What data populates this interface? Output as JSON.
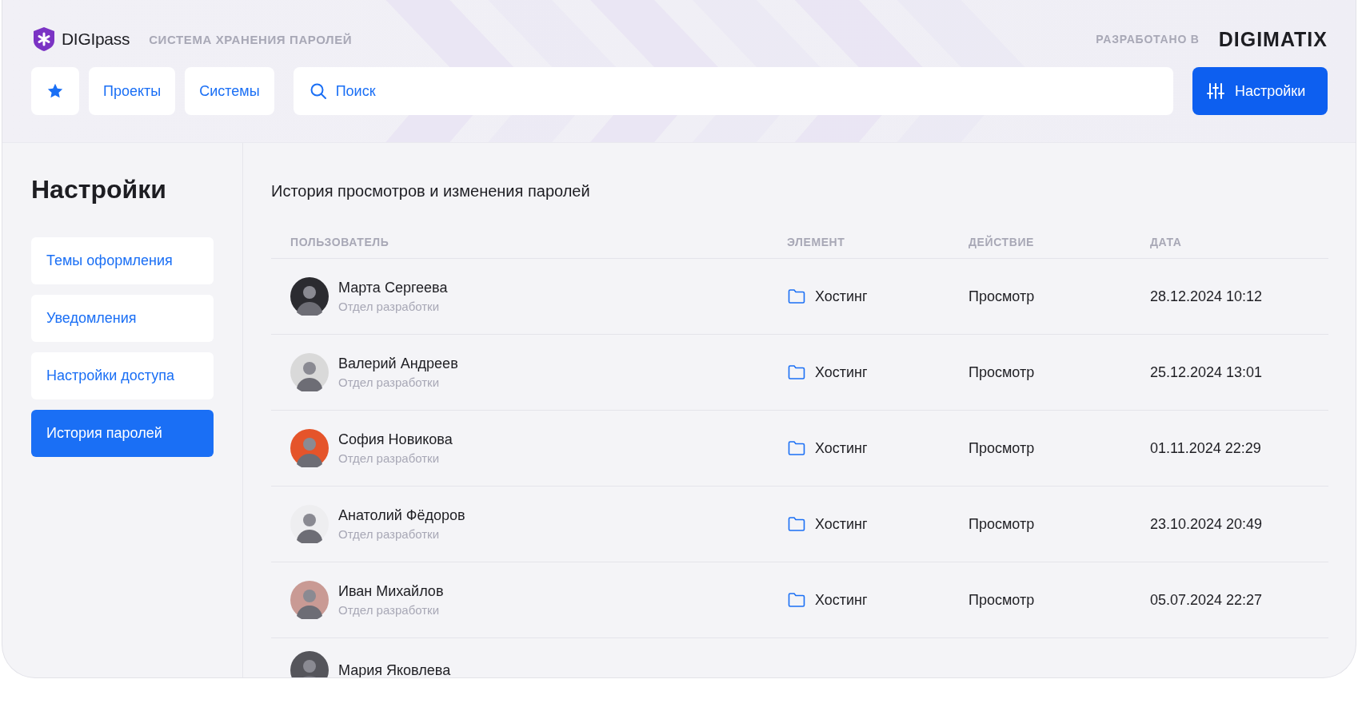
{
  "header": {
    "brand": "DIGIpass",
    "tagline": "СИСТЕМА ХРАНЕНИЯ ПАРОЛЕЙ",
    "credit": "РАЗРАБОТАНО В",
    "company": "DIGIMATIX",
    "nav": [
      "Проекты",
      "Системы"
    ],
    "search": {
      "placeholder": "Поиск"
    },
    "settings_button": "Настройки"
  },
  "sidebar": {
    "title": "Настройки",
    "items": [
      {
        "label": "Темы оформления",
        "selected": false
      },
      {
        "label": "Уведомления",
        "selected": false
      },
      {
        "label": "Настройки доступа",
        "selected": false
      },
      {
        "label": "История паролей",
        "selected": true
      }
    ]
  },
  "main": {
    "title": "История просмотров и изменения паролей",
    "table": {
      "columns": [
        "ПОЛЬЗОВАТЕЛЬ",
        "ЭЛЕМЕНТ",
        "ДЕЙСТВИЕ",
        "ДАТА"
      ],
      "rows": [
        {
          "name": "Марта Сергеева",
          "department": "Отдел разработки",
          "color": "#2b2b30",
          "element": "Хостинг",
          "action": "Просмотр",
          "date": "28.12.2024 10:12"
        },
        {
          "name": "Валерий Андреев",
          "department": "Отдел разработки",
          "color": "#d9d9d9",
          "element": "Хостинг",
          "action": "Просмотр",
          "date": "25.12.2024 13:01"
        },
        {
          "name": "София Новикова",
          "department": "Отдел разработки",
          "color": "#e5542a",
          "element": "Хостинг",
          "action": "Просмотр",
          "date": "01.11.2024 22:29"
        },
        {
          "name": "Анатолий Фёдоров",
          "department": "Отдел разработки",
          "color": "#eeeef0",
          "element": "Хостинг",
          "action": "Просмотр",
          "date": "23.10.2024 20:49"
        },
        {
          "name": "Иван Михайлов",
          "department": "Отдел разработки",
          "color": "#c99a94",
          "element": "Хостинг",
          "action": "Просмотр",
          "date": "05.07.2024 22:27"
        },
        {
          "name": "Мария Яковлева",
          "color": "#55555b"
        }
      ]
    }
  }
}
